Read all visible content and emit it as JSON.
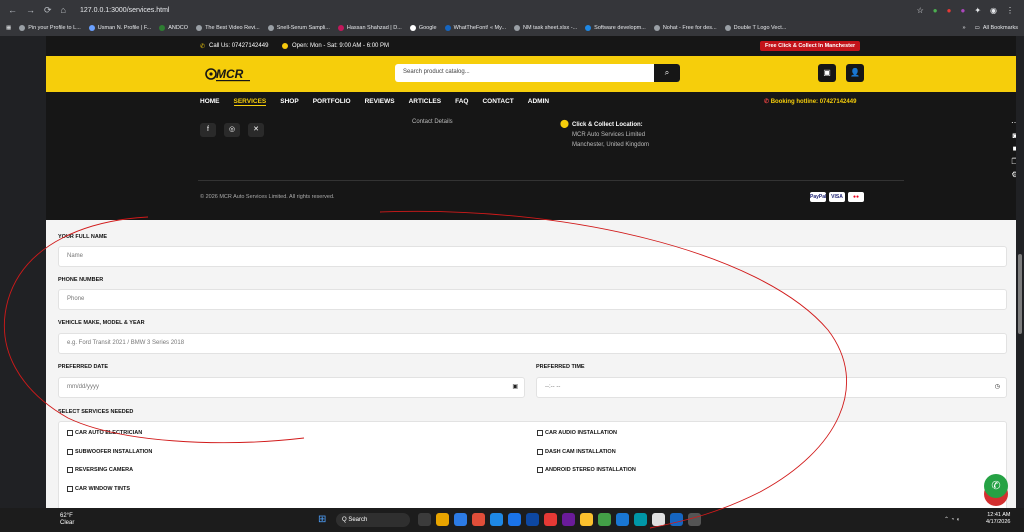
{
  "browser": {
    "url": "127.0.0.1:3000/services.html",
    "nav_glyphs": [
      "←",
      "→",
      "⟳",
      "⌂"
    ],
    "bookmarks": [
      "Pin your Profile to L...",
      "Usman N. Profile | F...",
      "ANDCO",
      "The Best Video Revi...",
      "Snell-Serum Sampli...",
      "Hassan Shahzad | D...",
      "Google",
      "WhatTheFont! « My...",
      "NM task sheet.xlsx -...",
      "Software developm...",
      "Nohat - Free for des...",
      "Double T Logo Vect..."
    ],
    "all_bookmarks": "All Bookmarks"
  },
  "topbar": {
    "call": "Call Us: 07427142449",
    "hours": "Open: Mon - Sat: 9:00 AM - 6:00 PM",
    "promo": "Free Click & Collect In Manchester"
  },
  "header": {
    "logo_text": "MCR",
    "search_placeholder": "Search product catalog...",
    "search_icon": "search-icon",
    "cart_icon": "bag-icon",
    "account_icon": "user-lock-icon"
  },
  "nav": {
    "items": [
      "HOME",
      "SERVICES",
      "SHOP",
      "PORTFOLIO",
      "REVIEWS",
      "ARTICLES",
      "FAQ",
      "CONTACT",
      "ADMIN"
    ],
    "active": "SERVICES",
    "hotline_label": "Booking hotline:",
    "hotline_number": "07427142449"
  },
  "footer": {
    "social": [
      "f",
      "◎",
      "🐦"
    ],
    "contact_link": "Contact Details",
    "location_title": "Click & Collect Location:",
    "location_line1": "MCR Auto Services Limited",
    "location_line2": "Manchester, United Kingdom",
    "copyright": "© 2026 MCR Auto Services Limited. All rights reserved.",
    "payments": [
      "PayPal",
      "VISA",
      "MC"
    ]
  },
  "form": {
    "name_label": "YOUR FULL NAME",
    "name_placeholder": "Name",
    "phone_label": "PHONE NUMBER",
    "phone_placeholder": "Phone",
    "vehicle_label": "VEHICLE MAKE, MODEL & YEAR",
    "vehicle_placeholder": "e.g. Ford Transit 2021 / BMW 3 Series 2018",
    "date_label": "PREFERRED DATE",
    "date_placeholder": "mm/dd/yyyy",
    "time_label": "PREFERRED TIME",
    "time_placeholder": "--:-- --",
    "services_label": "SELECT SERVICES NEEDED",
    "services_left": [
      "CAR AUTO ELECTRICIAN",
      "SUBWOOFER INSTALLATION",
      "REVERSING CAMERA",
      "CAR WINDOW TINTS"
    ],
    "services_right": [
      "CAR AUDIO INSTALLATION",
      "DASH CAM INSTALLATION",
      "ANDROID STEREO INSTALLATION"
    ]
  },
  "taskbar": {
    "weather_temp": "62°F",
    "weather_desc": "Clear",
    "search": "Q  Search",
    "time": "12:41 AM",
    "date": "4/17/2026"
  },
  "colors": {
    "brand_yellow": "#f6ce0b",
    "dark": "#161616",
    "promo_red": "#c3131a",
    "phone_fab": "#d32f2f",
    "whatsapp_fab": "#25a244",
    "annotation": "#d11a1a"
  }
}
